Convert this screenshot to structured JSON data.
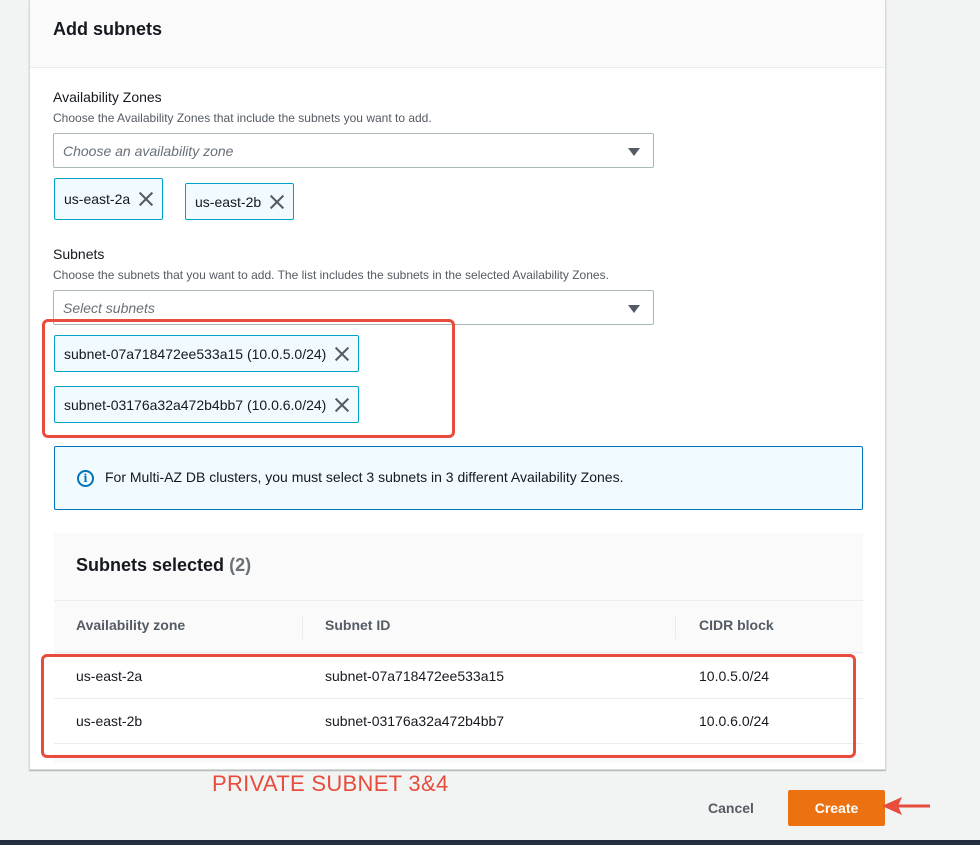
{
  "panel": {
    "title": "Add subnets"
  },
  "availability_zones": {
    "label": "Availability Zones",
    "description": "Choose the Availability Zones that include the subnets you want to add.",
    "placeholder": "Choose an availability zone",
    "selected": [
      "us-east-2a",
      "us-east-2b"
    ]
  },
  "subnets": {
    "label": "Subnets",
    "description": "Choose the subnets that you want to add. The list includes the subnets in the selected Availability Zones.",
    "placeholder": "Select subnets",
    "selected": [
      "subnet-07a718472ee533a15 (10.0.5.0/24)",
      "subnet-03176a32a472b4bb7 (10.0.6.0/24)"
    ]
  },
  "info": {
    "text": "For Multi-AZ DB clusters, you must select 3 subnets in 3 different Availability Zones."
  },
  "table": {
    "title": "Subnets selected",
    "count": "(2)",
    "columns": [
      "Availability zone",
      "Subnet ID",
      "CIDR block"
    ],
    "rows": [
      {
        "az": "us-east-2a",
        "subnet_id": "subnet-07a718472ee533a15",
        "cidr": "10.0.5.0/24"
      },
      {
        "az": "us-east-2b",
        "subnet_id": "subnet-03176a32a472b4bb7",
        "cidr": "10.0.6.0/24"
      }
    ]
  },
  "annotation": {
    "text": "PRIVATE SUBNET 3&4"
  },
  "actions": {
    "cancel_label": "Cancel",
    "create_label": "Create"
  },
  "colors": {
    "primary": "#ec7211",
    "link_blue": "#0073bb",
    "token_border": "#00a1c9",
    "annotation_red": "#e74c3c"
  }
}
